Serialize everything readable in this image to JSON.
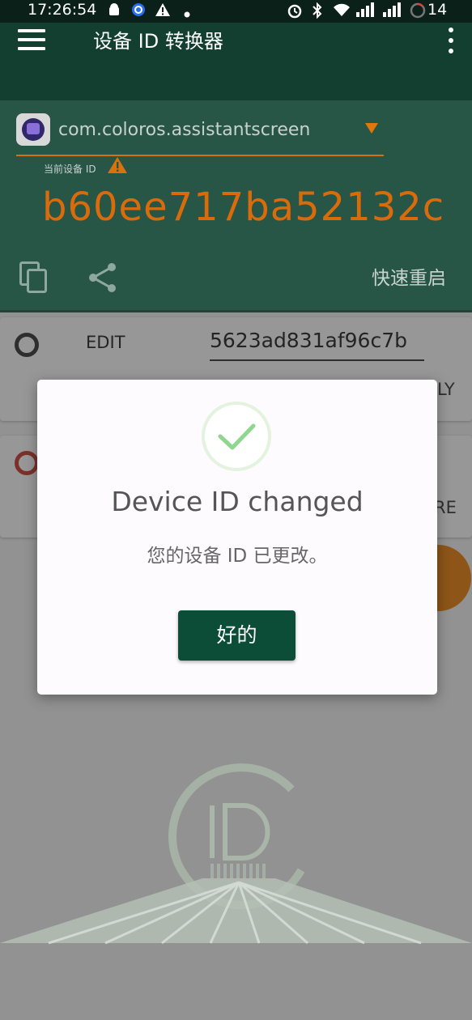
{
  "status_bar": {
    "time": "17:26:54",
    "battery": "14"
  },
  "app_bar": {
    "title": "设备 ID 转换器"
  },
  "header": {
    "package_name": "com.coloros.assistantscreen",
    "current_id_label": "当前设备 ID",
    "device_id": "b60ee717ba52132c",
    "quick_restart": "快速重启"
  },
  "edit_card": {
    "label": "EDIT",
    "input_value": "5623ad831af96c7b",
    "apply_partial": "LY"
  },
  "restore_card": {
    "restore_partial": "RE"
  },
  "dialog": {
    "title": "Device ID changed",
    "message": "您的设备 ID 已更改。",
    "ok_label": "好的"
  },
  "colors": {
    "app_bar": "#123f30",
    "header": "#275546",
    "accent": "#da6b0b",
    "ok_button": "#0b4d37",
    "check": "#8fd68f"
  },
  "icons": [
    "android-icon",
    "sync-icon",
    "warning-icon",
    "dot-icon",
    "alarm-icon",
    "bluetooth-icon",
    "wifi-icon",
    "signal-icon",
    "battery-icon",
    "menu-icon",
    "overflow-icon",
    "copy-icon",
    "share-icon",
    "check-icon"
  ]
}
